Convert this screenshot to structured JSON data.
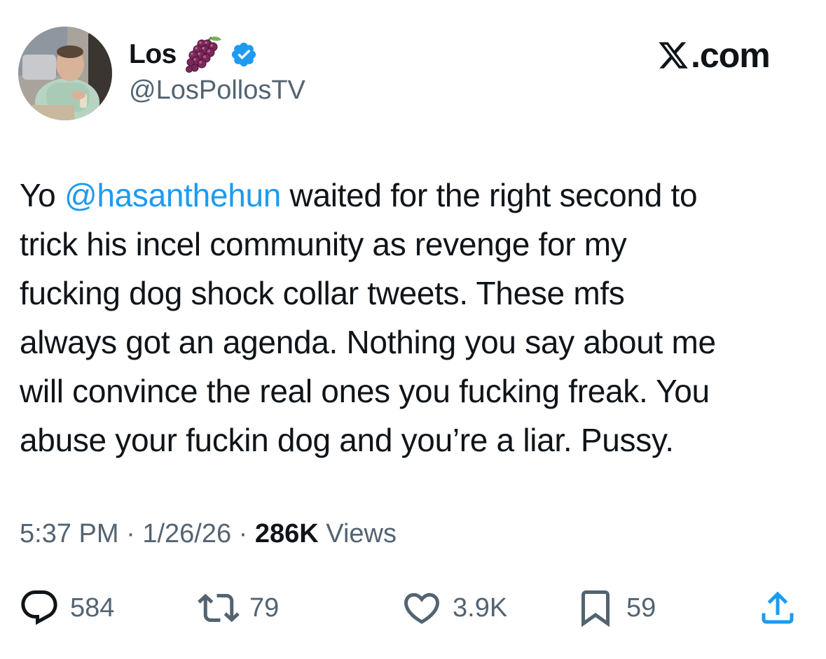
{
  "author": {
    "display_name": "Los",
    "handle": "@LosPollosTV",
    "name_emoji": "grapes-emoji",
    "verified_icon": "verified-badge-icon"
  },
  "brand": {
    "logo_letter": "X",
    "logo_suffix": ".com"
  },
  "tweet": {
    "lines": [
      {
        "pre": "Yo ",
        "mention": "@hasanthehun",
        "post": " waited for the right second to"
      },
      {
        "text": "trick his incel community as revenge for my"
      },
      {
        "text": "fucking dog shock collar tweets. These mfs"
      },
      {
        "text": "always got an agenda. Nothing you say about me"
      },
      {
        "text": "will convince the real ones you fucking freak. You"
      },
      {
        "text": "abuse your fuckin dog and you’re a liar. Pussy."
      }
    ]
  },
  "meta": {
    "time": "5:37 PM",
    "separator": " · ",
    "date": "1/26/26",
    "views_count": "286K",
    "views_label": " Views"
  },
  "actions": {
    "reply": {
      "icon": "reply-icon",
      "count": "584"
    },
    "retweet": {
      "icon": "retweet-icon",
      "count": "79"
    },
    "like": {
      "icon": "heart-icon",
      "count": "3.9K"
    },
    "bookmark": {
      "icon": "bookmark-icon",
      "count": "59"
    },
    "share": {
      "icon": "share-icon"
    }
  },
  "colors": {
    "text": "#0f1419",
    "muted": "#536471",
    "mention": "#1d9bf0",
    "verified": "#1d9bf0",
    "background": "#ffffff"
  }
}
